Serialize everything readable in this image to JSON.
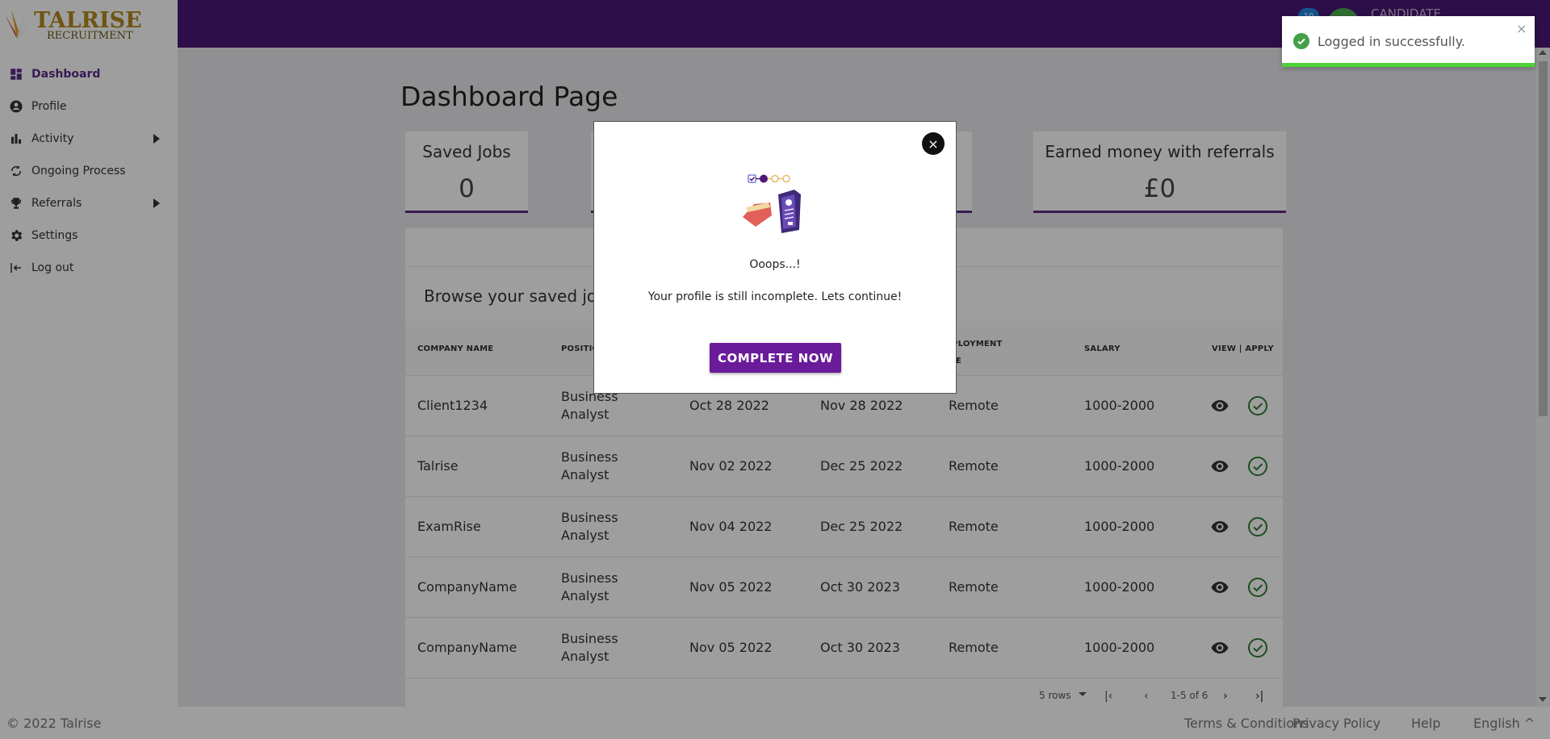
{
  "brand": {
    "name_line1": "TALRISE",
    "name_line2": "RECRUITMENT"
  },
  "sidebar": {
    "items": [
      {
        "label": "Dashboard",
        "icon": "dashboard-icon"
      },
      {
        "label": "Profile",
        "icon": "account-circle-icon"
      },
      {
        "label": "Activity",
        "icon": "bar-chart-icon"
      },
      {
        "label": "Ongoing Process",
        "icon": "sync-icon"
      },
      {
        "label": "Referrals",
        "icon": "trophy-icon"
      },
      {
        "label": "Settings",
        "icon": "gear-icon"
      },
      {
        "label": "Log out",
        "icon": "logout-icon"
      }
    ]
  },
  "topbar": {
    "notification_count": "10",
    "user_label": "CANDIDATE"
  },
  "page": {
    "title": "Dashboard Page"
  },
  "cards": [
    {
      "label": "Saved Jobs",
      "value": "0"
    },
    {
      "label": "Earned money with referrals",
      "value": "£0"
    }
  ],
  "jobs_table": {
    "title": "Browse your saved jobs",
    "headers": [
      "COMPANY NAME",
      "POSITION",
      "EMPLOYMENT TYPE",
      "SALARY",
      "VIEW | APPLY"
    ],
    "rows": [
      {
        "company": "Client1234",
        "position": "Business Analyst",
        "posted": "Oct 28 2022",
        "deadline": "Nov 28 2022",
        "type": "Remote",
        "salary": "1000-2000"
      },
      {
        "company": "Talrise",
        "position": "Business Analyst",
        "posted": "Nov 02 2022",
        "deadline": "Dec 25 2022",
        "type": "Remote",
        "salary": "1000-2000"
      },
      {
        "company": "ExamRise",
        "position": "Business Analyst",
        "posted": "Nov 04 2022",
        "deadline": "Dec 25 2022",
        "type": "Remote",
        "salary": "1000-2000"
      },
      {
        "company": "CompanyName",
        "position": "Business Analyst",
        "posted": "Nov 05 2022",
        "deadline": "Oct 30 2023",
        "type": "Remote",
        "salary": "1000-2000"
      },
      {
        "company": "CompanyName",
        "position": "Business Analyst",
        "posted": "Nov 05 2022",
        "deadline": "Oct 30 2023",
        "type": "Remote",
        "salary": "1000-2000"
      }
    ],
    "pagination": {
      "rows_per_page": "5 rows",
      "range": "1-5 of 6"
    }
  },
  "toast": {
    "message": "Logged in successfully.",
    "close": "×"
  },
  "modal": {
    "title": "Ooops...!",
    "message": "Your profile is still incomplete. Lets continue!",
    "button": "COMPLETE NOW",
    "close": "×"
  },
  "footer": {
    "copyright": "© 2022 Talrise",
    "links": [
      "Terms & Conditions",
      "Privacy Policy",
      "Help",
      "English ^"
    ]
  },
  "colors": {
    "primary": "#4b1876",
    "accent": "#6a1b9a",
    "success": "#43a047"
  }
}
